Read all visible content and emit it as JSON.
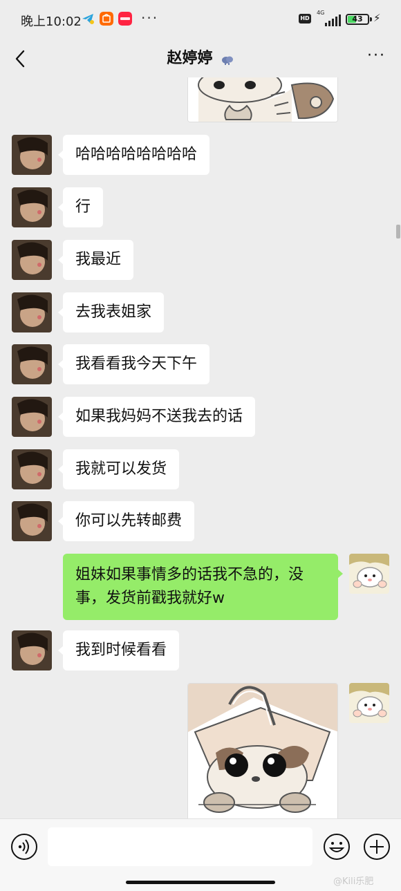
{
  "status_bar": {
    "time": "晚上10:02",
    "network": "4G",
    "battery_percent": "43",
    "battery_level": 0.43,
    "icons": [
      "telegram-icon",
      "taobao-icon",
      "xiaohongshu-icon",
      "more-dots-icon",
      "hd-icon",
      "signal-icon",
      "battery-icon",
      "charging-icon"
    ],
    "colors": {
      "telegram": "#2aa3dc",
      "taobao": "#ff6a00",
      "xiaohongshu": "#ff2442"
    }
  },
  "nav": {
    "title": "赵婷婷",
    "title_icon": "weather-cloud-icon",
    "back_icon": "chevron-left-icon",
    "more_icon": "more-dots-icon"
  },
  "messages": [
    {
      "side": "out",
      "type": "sticker",
      "sticker": "cat-cartoon-sticker-top"
    },
    {
      "side": "in",
      "type": "text",
      "text": "哈哈哈哈哈哈哈哈"
    },
    {
      "side": "in",
      "type": "text",
      "text": "行"
    },
    {
      "side": "in",
      "type": "text",
      "text": "我最近"
    },
    {
      "side": "in",
      "type": "text",
      "text": "去我表姐家"
    },
    {
      "side": "in",
      "type": "text",
      "text": "我看看我今天下午"
    },
    {
      "side": "in",
      "type": "text",
      "text": "如果我妈妈不送我去的话"
    },
    {
      "side": "in",
      "type": "text",
      "text": "我就可以发货"
    },
    {
      "side": "in",
      "type": "text",
      "text": "你可以先转邮费"
    },
    {
      "side": "out",
      "type": "text",
      "lines": [
        "姐妹如果事情多的话我不急的，没",
        "事，发货前戳我就好w"
      ]
    },
    {
      "side": "in",
      "type": "text",
      "text": "我到时候看看"
    },
    {
      "side": "out",
      "type": "sticker",
      "sticker": "cat-in-paper-bag-sticker"
    }
  ],
  "input_bar": {
    "placeholder": "",
    "voice_icon": "voice-icon",
    "emoji_icon": "emoji-icon",
    "plus_icon": "plus-icon"
  },
  "colors": {
    "background": "#ededed",
    "bubble_in": "#ffffff",
    "bubble_out": "#95ec69"
  },
  "watermark": "@Kili乐肥"
}
